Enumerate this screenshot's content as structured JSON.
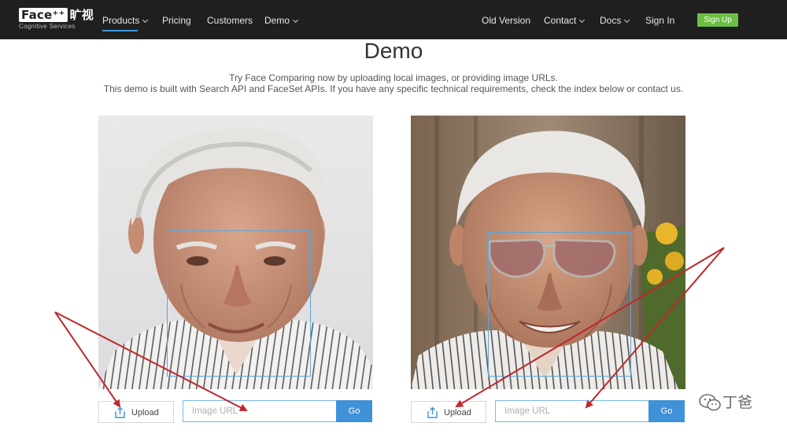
{
  "nav": {
    "logo": {
      "mark": "Face⁺⁺",
      "cn": "旷视",
      "sub": "Cognitive Services"
    },
    "items_left": [
      "Products",
      "Pricing",
      "Customers",
      "Demo"
    ],
    "items_right": [
      "Old Version",
      "Contact",
      "Docs",
      "Sign In"
    ],
    "signup": "Sign Up",
    "active_item": "Products"
  },
  "page": {
    "title": "Demo",
    "desc1": "Try Face Comparing now by uploading local images, or providing image URLs.",
    "desc2": "This demo is built with Search API and FaceSet APIs. If you have any specific technical requirements, check the index below or contact us."
  },
  "controls": {
    "left": {
      "upload": "Upload",
      "url_placeholder": "Image URL",
      "go": "Go"
    },
    "right": {
      "upload": "Upload",
      "url_placeholder": "Image URL",
      "go": "Go"
    }
  },
  "watermark": {
    "text": "丁爸"
  },
  "colors": {
    "nav_bg": "#1f1f1f",
    "accent": "#3f91d8",
    "signup": "#6dbe45",
    "facebox": "#5aa7dd",
    "arrow": "#c0272d"
  },
  "icons": [
    "upload-icon",
    "chevron-down-icon",
    "wechat-icon"
  ]
}
